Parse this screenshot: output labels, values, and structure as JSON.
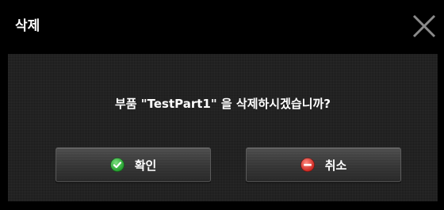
{
  "dialog": {
    "title": "삭제",
    "message": "부품 \"TestPart1\" 을 삭제하시겠습니까?",
    "confirm_label": "확인",
    "cancel_label": "취소"
  },
  "icons": {
    "close": "close-icon",
    "confirm": "check-circle-icon",
    "cancel": "minus-circle-icon"
  },
  "colors": {
    "background": "#000000",
    "panel": "#1a1a1a",
    "confirm_icon": "#3fbf4a",
    "cancel_icon": "#e0403a"
  }
}
